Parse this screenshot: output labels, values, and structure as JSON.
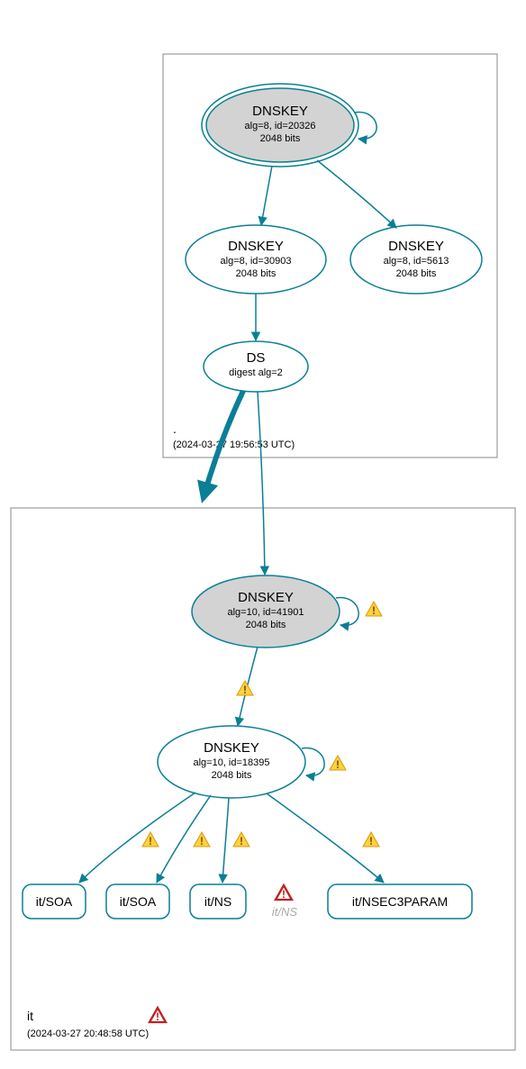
{
  "zones": {
    "root": {
      "label": ".",
      "timestamp": "(2024-03-27 19:56:53 UTC)"
    },
    "it": {
      "label": "it",
      "timestamp": "(2024-03-27 20:48:58 UTC)"
    }
  },
  "nodes": {
    "root_ksk": {
      "title": "DNSKEY",
      "line2": "alg=8, id=20326",
      "line3": "2048 bits"
    },
    "root_zsk": {
      "title": "DNSKEY",
      "line2": "alg=8, id=30903",
      "line3": "2048 bits"
    },
    "root_other": {
      "title": "DNSKEY",
      "line2": "alg=8, id=5613",
      "line3": "2048 bits"
    },
    "root_ds": {
      "title": "DS",
      "line2": "digest alg=2"
    },
    "it_ksk": {
      "title": "DNSKEY",
      "line2": "alg=10, id=41901",
      "line3": "2048 bits"
    },
    "it_zsk": {
      "title": "DNSKEY",
      "line2": "alg=10, id=18395",
      "line3": "2048 bits"
    },
    "rr_soa1": {
      "label": "it/SOA"
    },
    "rr_soa2": {
      "label": "it/SOA"
    },
    "rr_ns": {
      "label": "it/NS"
    },
    "rr_ns_gray": {
      "label": "it/NS"
    },
    "rr_nsec3": {
      "label": "it/NSEC3PARAM"
    }
  }
}
